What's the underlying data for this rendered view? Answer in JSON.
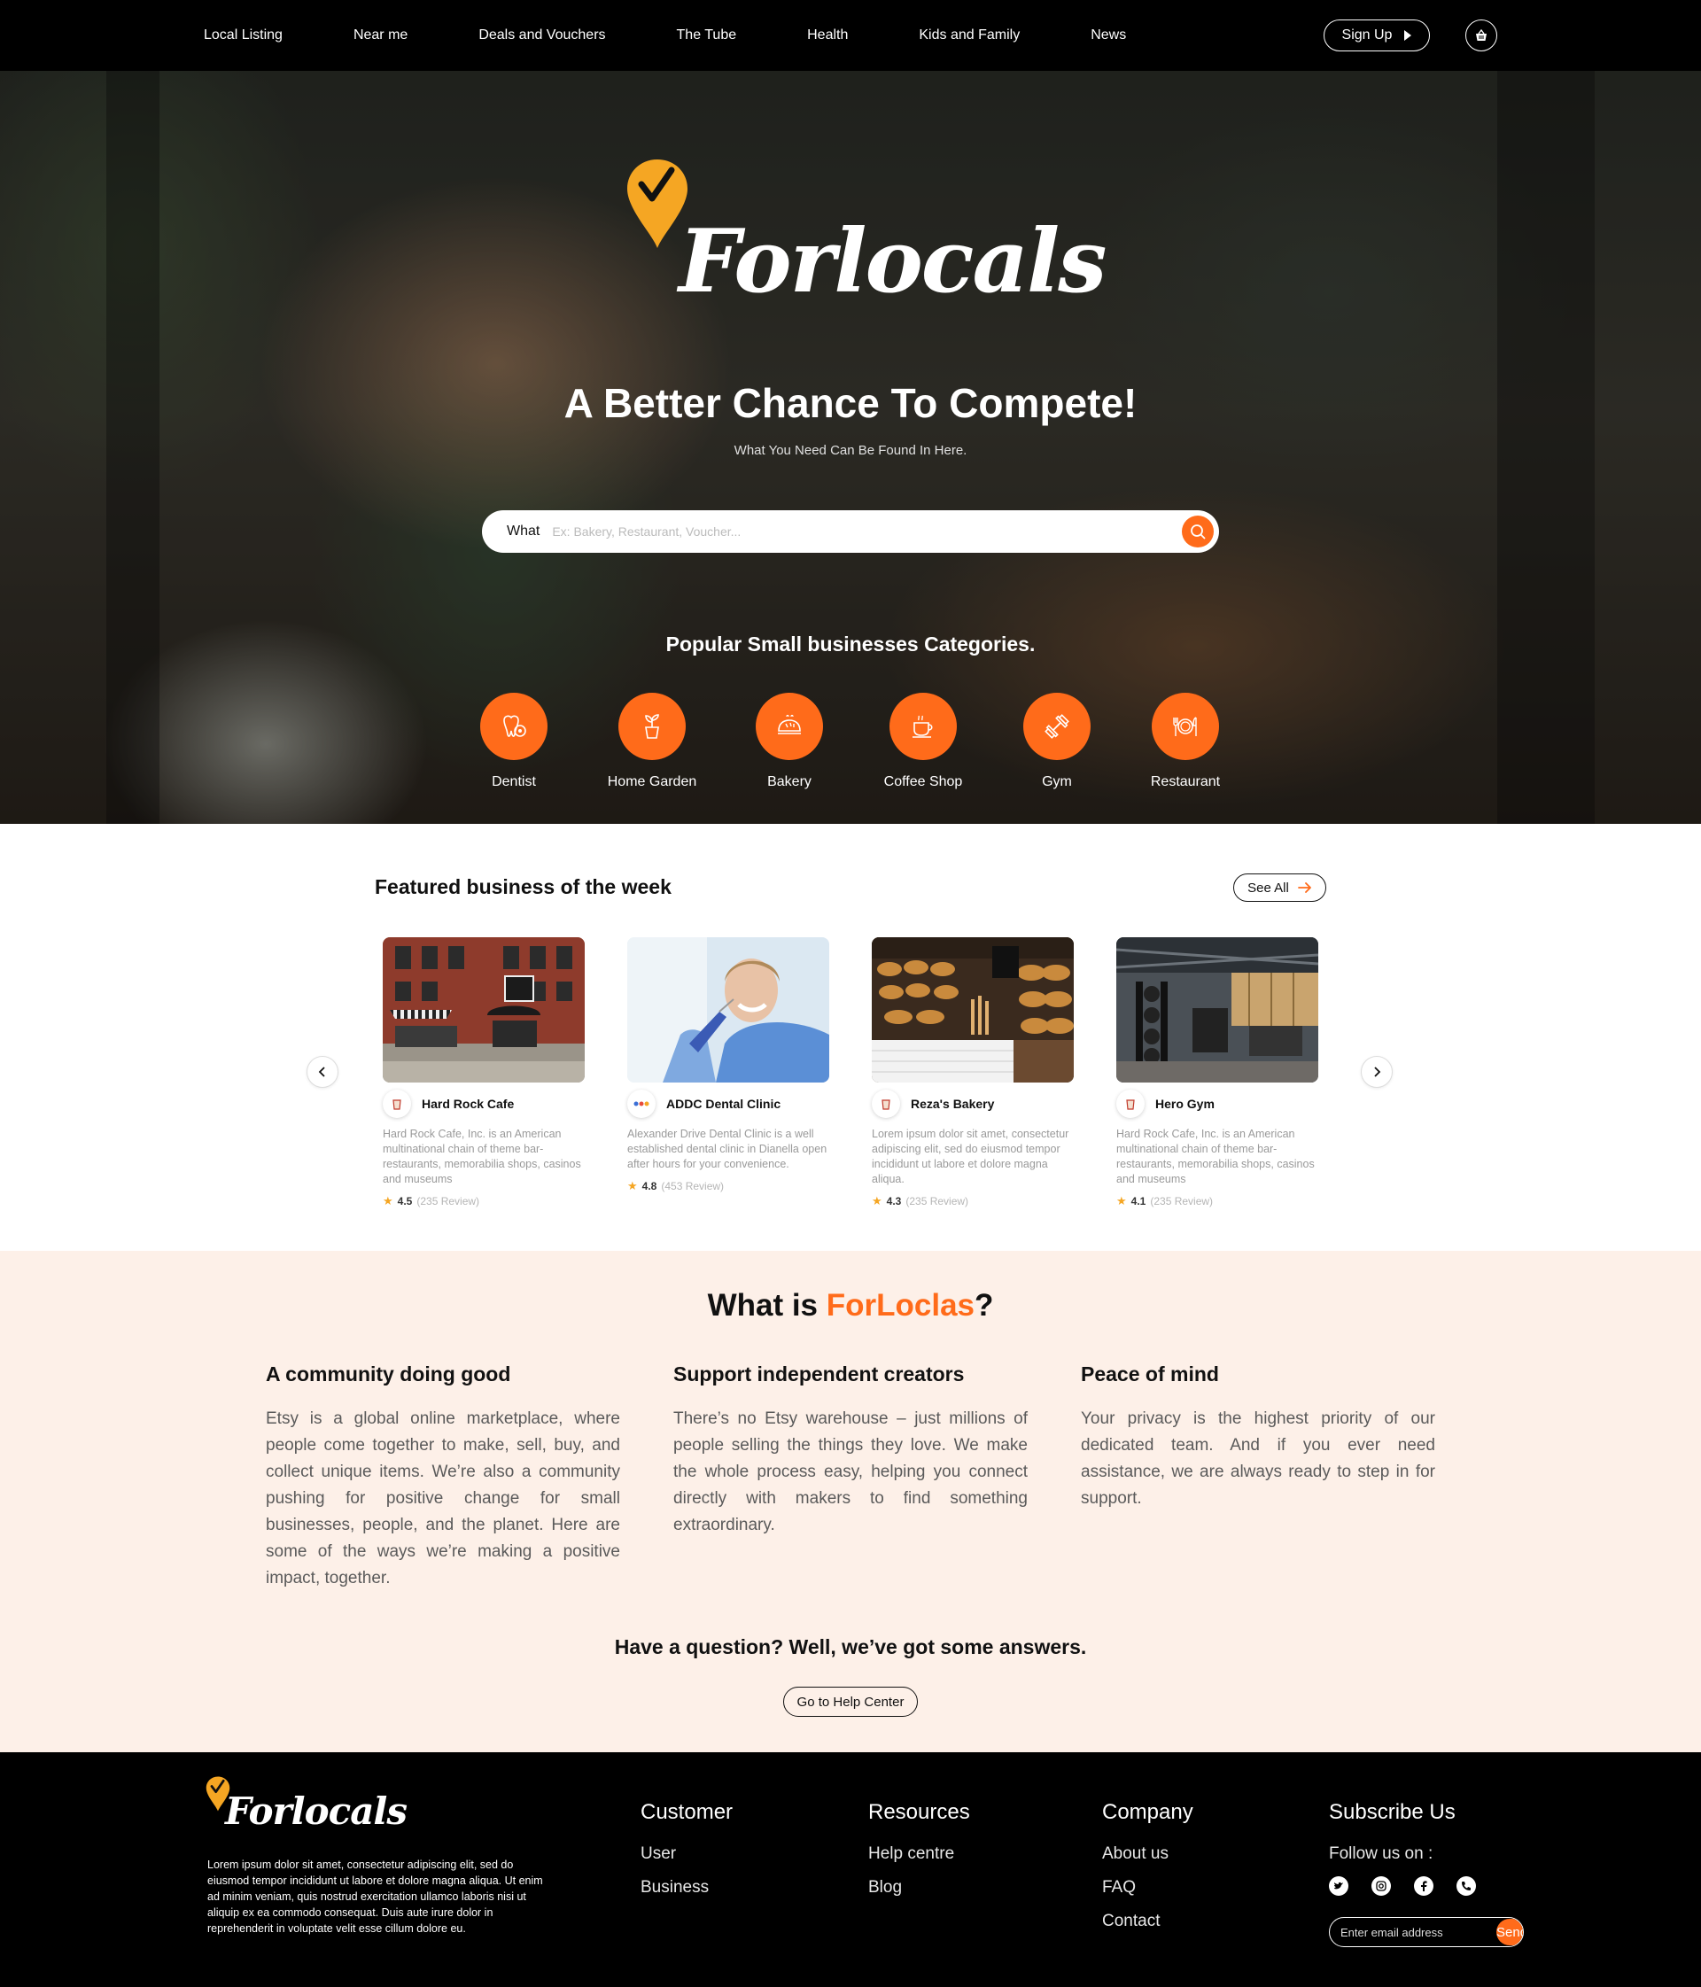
{
  "nav": {
    "links": [
      "Local Listing",
      "Near me",
      "Deals and Vouchers",
      "The Tube",
      "Health",
      "Kids and Family",
      "News"
    ],
    "signup_label": "Sign Up"
  },
  "hero": {
    "brand": "Forlocals",
    "headline": "A Better Chance To Compete!",
    "subheadline": "What You Need Can Be Found In Here.",
    "search_label": "What",
    "search_placeholder": "Ex: Bakery, Restaurant, Voucher...",
    "categories_title": "Popular Small businesses Categories.",
    "categories": [
      {
        "label": "Dentist",
        "icon": "tooth-icon"
      },
      {
        "label": "Home Garden",
        "icon": "plant-icon"
      },
      {
        "label": "Bakery",
        "icon": "bread-icon"
      },
      {
        "label": "Coffee Shop",
        "icon": "coffee-cup-icon"
      },
      {
        "label": "Gym",
        "icon": "dumbbell-icon"
      },
      {
        "label": "Restaurant",
        "icon": "plate-cutlery-icon"
      }
    ]
  },
  "featured": {
    "title": "Featured business of the week",
    "see_all_label": "See All",
    "cards": [
      {
        "name": "Hard Rock Cafe",
        "desc": "Hard Rock Cafe, Inc. is an American multinational chain of theme bar-restaurants, memorabilia shops, casinos and museums",
        "rating": "4.5",
        "reviews": "(235 Review)"
      },
      {
        "name": "ADDC Dental Clinic",
        "desc": "Alexander Drive Dental Clinic is a well established dental clinic in Dianella open after hours for your convenience.",
        "rating": "4.8",
        "reviews": "(453 Review)"
      },
      {
        "name": "Reza's Bakery",
        "desc": "Lorem ipsum dolor sit amet, consectetur adipiscing elit, sed do eiusmod tempor incididunt ut labore et dolore magna aliqua.",
        "rating": "4.3",
        "reviews": "(235 Review)"
      },
      {
        "name": "Hero Gym",
        "desc": "Hard Rock Cafe, Inc. is an American multinational chain of theme bar-restaurants, memorabilia shops, casinos and museums",
        "rating": "4.1",
        "reviews": "(235 Review)"
      }
    ]
  },
  "whatis": {
    "title_prefix": "What is ",
    "title_accent": "ForLoclas",
    "title_suffix": "?",
    "columns": [
      {
        "title": "A community doing good",
        "text": "Etsy is a global online marketplace, where people come together to make, sell, buy, and collect unique items. We’re also a community pushing for positive change for small businesses, people, and the planet. Here are some of the ways we’re making a positive impact, together."
      },
      {
        "title": "Support independent creators",
        "text": "There’s no Etsy warehouse – just millions of people selling the things they love. We make the whole process easy, helping you connect directly with makers to find something extraordinary."
      },
      {
        "title": "Peace of mind",
        "text": "Your privacy is the highest priority of our dedicated team. And if you ever need assistance, we are always ready to step in for support."
      }
    ],
    "question": "Have a question? Well, we’ve got some answers.",
    "help_label": "Go to Help Center"
  },
  "footer": {
    "brand": "Forlocals",
    "about": "Lorem ipsum dolor sit amet, consectetur adipiscing elit, sed do eiusmod tempor incididunt ut labore et dolore magna aliqua. Ut enim ad minim veniam, quis nostrud exercitation ullamco laboris nisi ut aliquip ex ea commodo consequat. Duis aute irure dolor in reprehenderit in voluptate velit esse cillum dolore eu.",
    "customer": {
      "title": "Customer",
      "links": [
        "User",
        "Business"
      ]
    },
    "resources": {
      "title": "Resources",
      "links": [
        "Help centre",
        "Blog"
      ]
    },
    "company": {
      "title": "Company",
      "links": [
        "About us",
        "FAQ",
        "Contact"
      ]
    },
    "subscribe": {
      "title": "Subscribe Us",
      "follow": "Follow us on :",
      "placeholder": "Enter email address",
      "send_label": "Send"
    }
  },
  "colors": {
    "accent": "#ff6b1a",
    "nav_bg": "#000000",
    "section_bg": "#fdf0e8",
    "star": "#f5a623"
  }
}
